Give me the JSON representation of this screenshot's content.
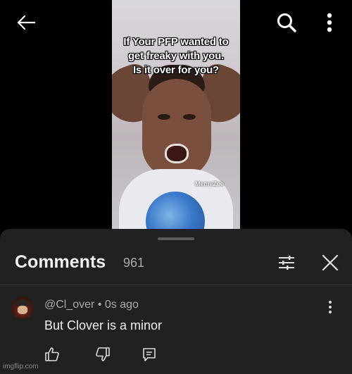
{
  "video": {
    "caption_lines": [
      "If Your PFP wanted to",
      "get freaky with you.",
      "Is it over for you?"
    ],
    "watermark": "MemeZee"
  },
  "topbar": {
    "back_icon": "arrow-left-icon",
    "search_icon": "search-icon",
    "more_icon": "more-vert-icon"
  },
  "comments": {
    "title": "Comments",
    "count": "961",
    "filter_icon": "sliders-icon",
    "close_icon": "close-icon",
    "items": [
      {
        "author": "@Cl_over",
        "time": "0s ago",
        "separator": "•",
        "text": "But Clover is a minor",
        "more_icon": "more-vert-icon",
        "like_icon": "thumbs-up-icon",
        "dislike_icon": "thumbs-down-icon",
        "reply_icon": "reply-icon"
      }
    ]
  },
  "footer": {
    "watermark": "imgflip.com"
  },
  "colors": {
    "background": "#000000",
    "sheet": "#212121",
    "primary_text": "#f1f1f1",
    "secondary_text": "#aaaaaa"
  }
}
